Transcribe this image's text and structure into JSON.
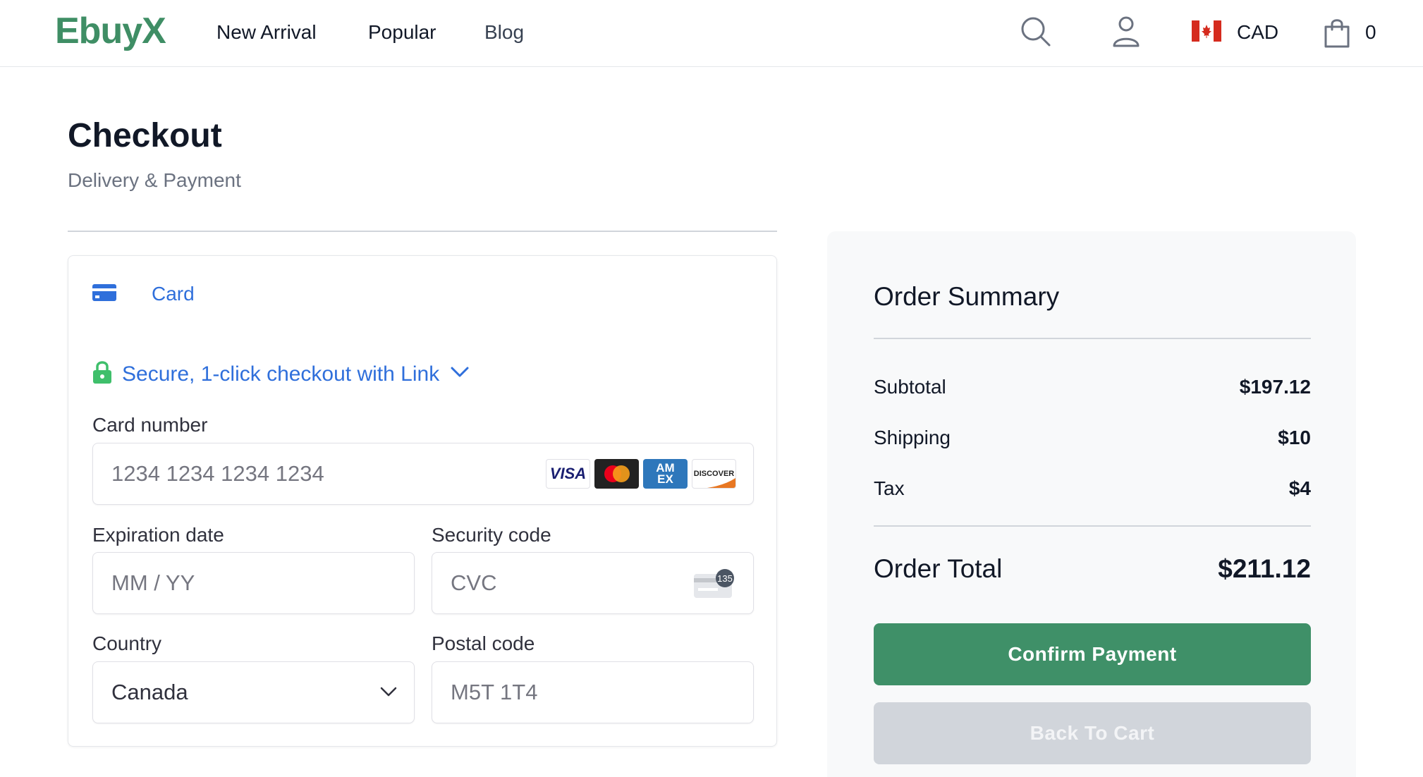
{
  "header": {
    "logo": "EbuyX",
    "nav": [
      "New Arrival",
      "Popular",
      "Blog"
    ],
    "icons": [
      "search-icon",
      "user-icon",
      "canada-flag-icon",
      "shopping-bag-icon"
    ],
    "currency": "CAD",
    "cart_count": "0"
  },
  "page": {
    "title": "Checkout",
    "subtitle": "Delivery & Payment"
  },
  "payment": {
    "tab_label": "Card",
    "link_text": "Secure, 1-click checkout with Link",
    "card_number": {
      "label": "Card number",
      "placeholder": "1234 1234 1234 1234"
    },
    "card_brands": [
      {
        "name": "VISA",
        "color": "#1a1f71"
      },
      {
        "name": "mastercard",
        "color": "#222222"
      },
      {
        "name": "AM EX",
        "color": "#2e77bb"
      },
      {
        "name": "DISCOVER",
        "color": "#e87722"
      }
    ],
    "expiration": {
      "label": "Expiration date",
      "placeholder": "MM / YY"
    },
    "security": {
      "label": "Security code",
      "placeholder": "CVC",
      "icon_badge": "135"
    },
    "country": {
      "label": "Country",
      "value": "Canada"
    },
    "postal": {
      "label": "Postal code",
      "placeholder": "M5T 1T4"
    }
  },
  "summary": {
    "title": "Order Summary",
    "rows": [
      {
        "label": "Subtotal",
        "value": "$197.12"
      },
      {
        "label": "Shipping",
        "value": "$10"
      },
      {
        "label": "Tax",
        "value": "$4"
      }
    ],
    "total_label": "Order Total",
    "total_value": "$211.12",
    "confirm_label": "Confirm Payment",
    "back_label": "Back To Cart"
  },
  "colors": {
    "brand_green": "#3f8e65",
    "link_blue": "#2f6fdb",
    "lock_green": "#3fbf6b",
    "button_green": "#3f9068",
    "button_disabled": "#d1d5db"
  }
}
